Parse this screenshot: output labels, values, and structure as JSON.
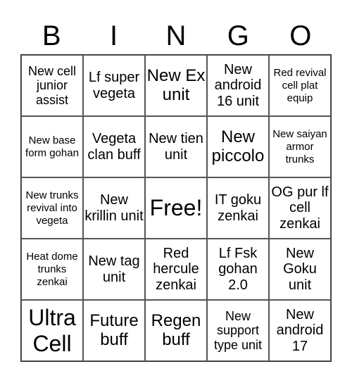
{
  "header": {
    "letters": [
      "B",
      "I",
      "N",
      "G",
      "O"
    ]
  },
  "cells": [
    [
      "New cell junior assist",
      "Lf super vegeta",
      "New Ex unit",
      "New android 16 unit",
      "Red revival cell plat equip"
    ],
    [
      "New base form gohan",
      "Vegeta clan buff",
      "New tien unit",
      "New piccolo",
      "New saiyan armor trunks"
    ],
    [
      "New trunks revival into vegeta",
      "New krillin unit",
      "Free!",
      "IT goku zenkai",
      "OG pur lf cell zenkai"
    ],
    [
      "Heat dome trunks zenkai",
      "New tag unit",
      "Red hercule zenkai",
      "Lf Fsk gohan 2.0",
      "New Goku unit"
    ],
    [
      "Ultra Cell",
      "Future buff",
      "Regen buff",
      "New support type unit",
      "New android 17"
    ]
  ]
}
